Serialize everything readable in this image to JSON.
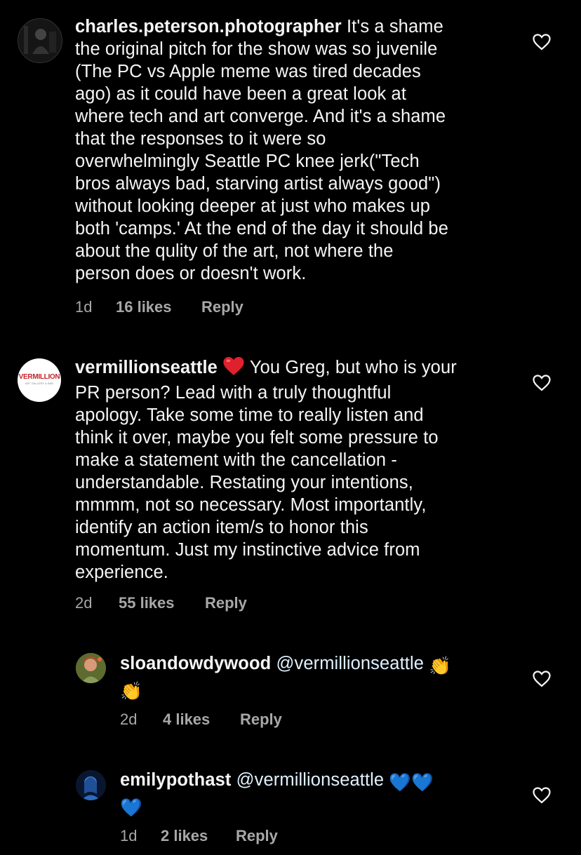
{
  "comments": [
    {
      "username": "charles.peterson.photographer",
      "lines": [
        " It's a shame",
        "the original pitch for the show was so juvenile",
        "(The PC vs Apple meme was tired decades",
        "ago) as it could have been a great look at",
        "where tech and art converge. And it's a shame",
        "that the responses to it were so",
        "overwhelmingly Seattle PC knee jerk(\"Tech",
        "bros always bad, starving artist always good\")",
        "without looking deeper at just who makes up",
        "both 'camps.' At the end of the day it should be",
        "about the qulity of the art, not where the",
        "person does or doesn't work."
      ],
      "time": "1d",
      "likes": "16 likes",
      "reply": "Reply",
      "avatar_icon": "photographer-avatar"
    },
    {
      "username": "vermillionseattle",
      "avatar_text": "VERMILLION",
      "avatar_subtext": "ART GALLERY & BAR",
      "first_line_emoji": "❤️",
      "lines": [
        " You Greg, but who is your",
        "PR person? Lead with a truly thoughtful",
        "apology. Take some time to really listen and",
        "think it over, maybe you felt some pressure to",
        "make a statement with the cancellation -",
        "understandable. Restating your intentions,",
        "mmmm, not so necessary. Most importantly,",
        "identify an action item/s to honor this",
        "momentum. Just my instinctive advice from",
        "experience."
      ],
      "time": "2d",
      "likes": "55 likes",
      "reply": "Reply"
    },
    {
      "username": "sloandowdywood",
      "mention": "@vermillionseattle",
      "emoji": "👏",
      "emoji_line2": "👏",
      "time": "2d",
      "likes": "4 likes",
      "reply": "Reply"
    },
    {
      "username": "emilypothast",
      "mention": "@vermillionseattle",
      "emoji": "💙💙",
      "emoji_line2": "💙",
      "time": "1d",
      "likes": "2 likes",
      "reply": "Reply"
    }
  ],
  "colors": {
    "background": "#000000",
    "text": "#f5f5f5",
    "meta": "#a8a8a8",
    "heart_red": "#ed4956",
    "blue_heart": "#1877f2"
  }
}
